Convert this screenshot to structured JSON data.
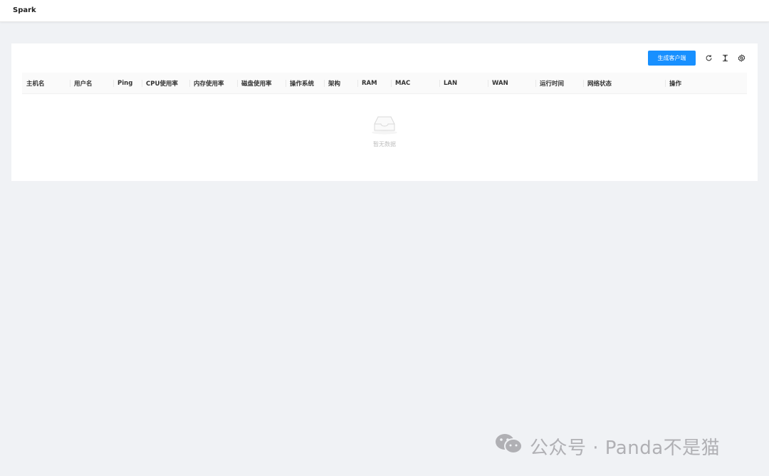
{
  "app": {
    "title": "Spark"
  },
  "toolbar": {
    "generate_client_label": "生成客户端",
    "icons": [
      "refresh-icon",
      "column-height-icon",
      "settings-icon"
    ]
  },
  "table": {
    "columns": [
      "主机名",
      "用户名",
      "Ping",
      "CPU使用率",
      "内存使用率",
      "磁盘使用率",
      "操作系统",
      "架构",
      "RAM",
      "MAC",
      "LAN",
      "WAN",
      "运行时间",
      "网络状态",
      "操作"
    ],
    "empty_text": "暂无数据"
  },
  "watermark": {
    "text": "公众号 · Panda不是猫"
  },
  "colors": {
    "primary": "#1890ff",
    "background": "#f0f2f5"
  }
}
